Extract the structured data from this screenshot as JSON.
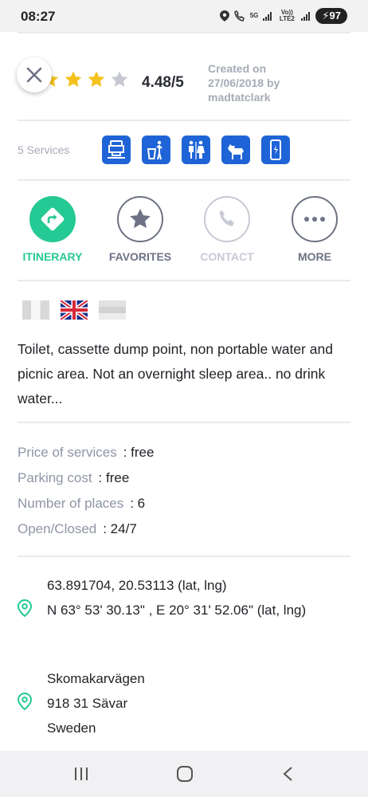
{
  "status_bar": {
    "time": "08:27",
    "network_5g": "5G",
    "volte": "Vo)) LTE2",
    "battery": "97"
  },
  "colors": {
    "accent_green": "#25c993",
    "service_blue": "#1f64d6",
    "star_yellow": "#f4c21c",
    "muted_text": "#a7abb7"
  },
  "rating": {
    "value": "4.48/5",
    "stars_filled_approx": 4,
    "stars_total": 5
  },
  "created": {
    "line1": "Created on",
    "line2": "27/06/2018 by",
    "line3": "madtatclark"
  },
  "services": {
    "label": "5 Services",
    "icons": [
      "cassette-dump-icon",
      "trash-icon",
      "toilet-icon",
      "dog-icon",
      "phone-charging-icon"
    ]
  },
  "actions": [
    {
      "label": "ITINERARY",
      "icon": "directions-icon"
    },
    {
      "label": "FAVORITES",
      "icon": "star-icon"
    },
    {
      "label": "CONTACT",
      "icon": "phone-icon"
    },
    {
      "label": "MORE",
      "icon": "more-icon"
    }
  ],
  "languages": [
    "italian-flag-icon",
    "uk-flag-icon",
    "other-flag-icon"
  ],
  "description": "Toilet, cassette dump point, non portable water and picnic area. Not an overnight sleep area.. no drink water...",
  "info": [
    {
      "label": "Price of services",
      "value": ": free"
    },
    {
      "label": "Parking cost",
      "value": ": free"
    },
    {
      "label": "Number of places",
      "value": ": 6"
    },
    {
      "label": "Open/Closed",
      "value": ": 24/7"
    }
  ],
  "coordinates": {
    "decimal": "63.891704, 20.53113 (lat, lng)",
    "dms": "N 63° 53' 30.13\" , E 20° 31' 52.06\" (lat, lng)"
  },
  "address": {
    "street": "Skomakarvägen",
    "postal_city": "918 31 Sävar",
    "country": "Sweden"
  }
}
